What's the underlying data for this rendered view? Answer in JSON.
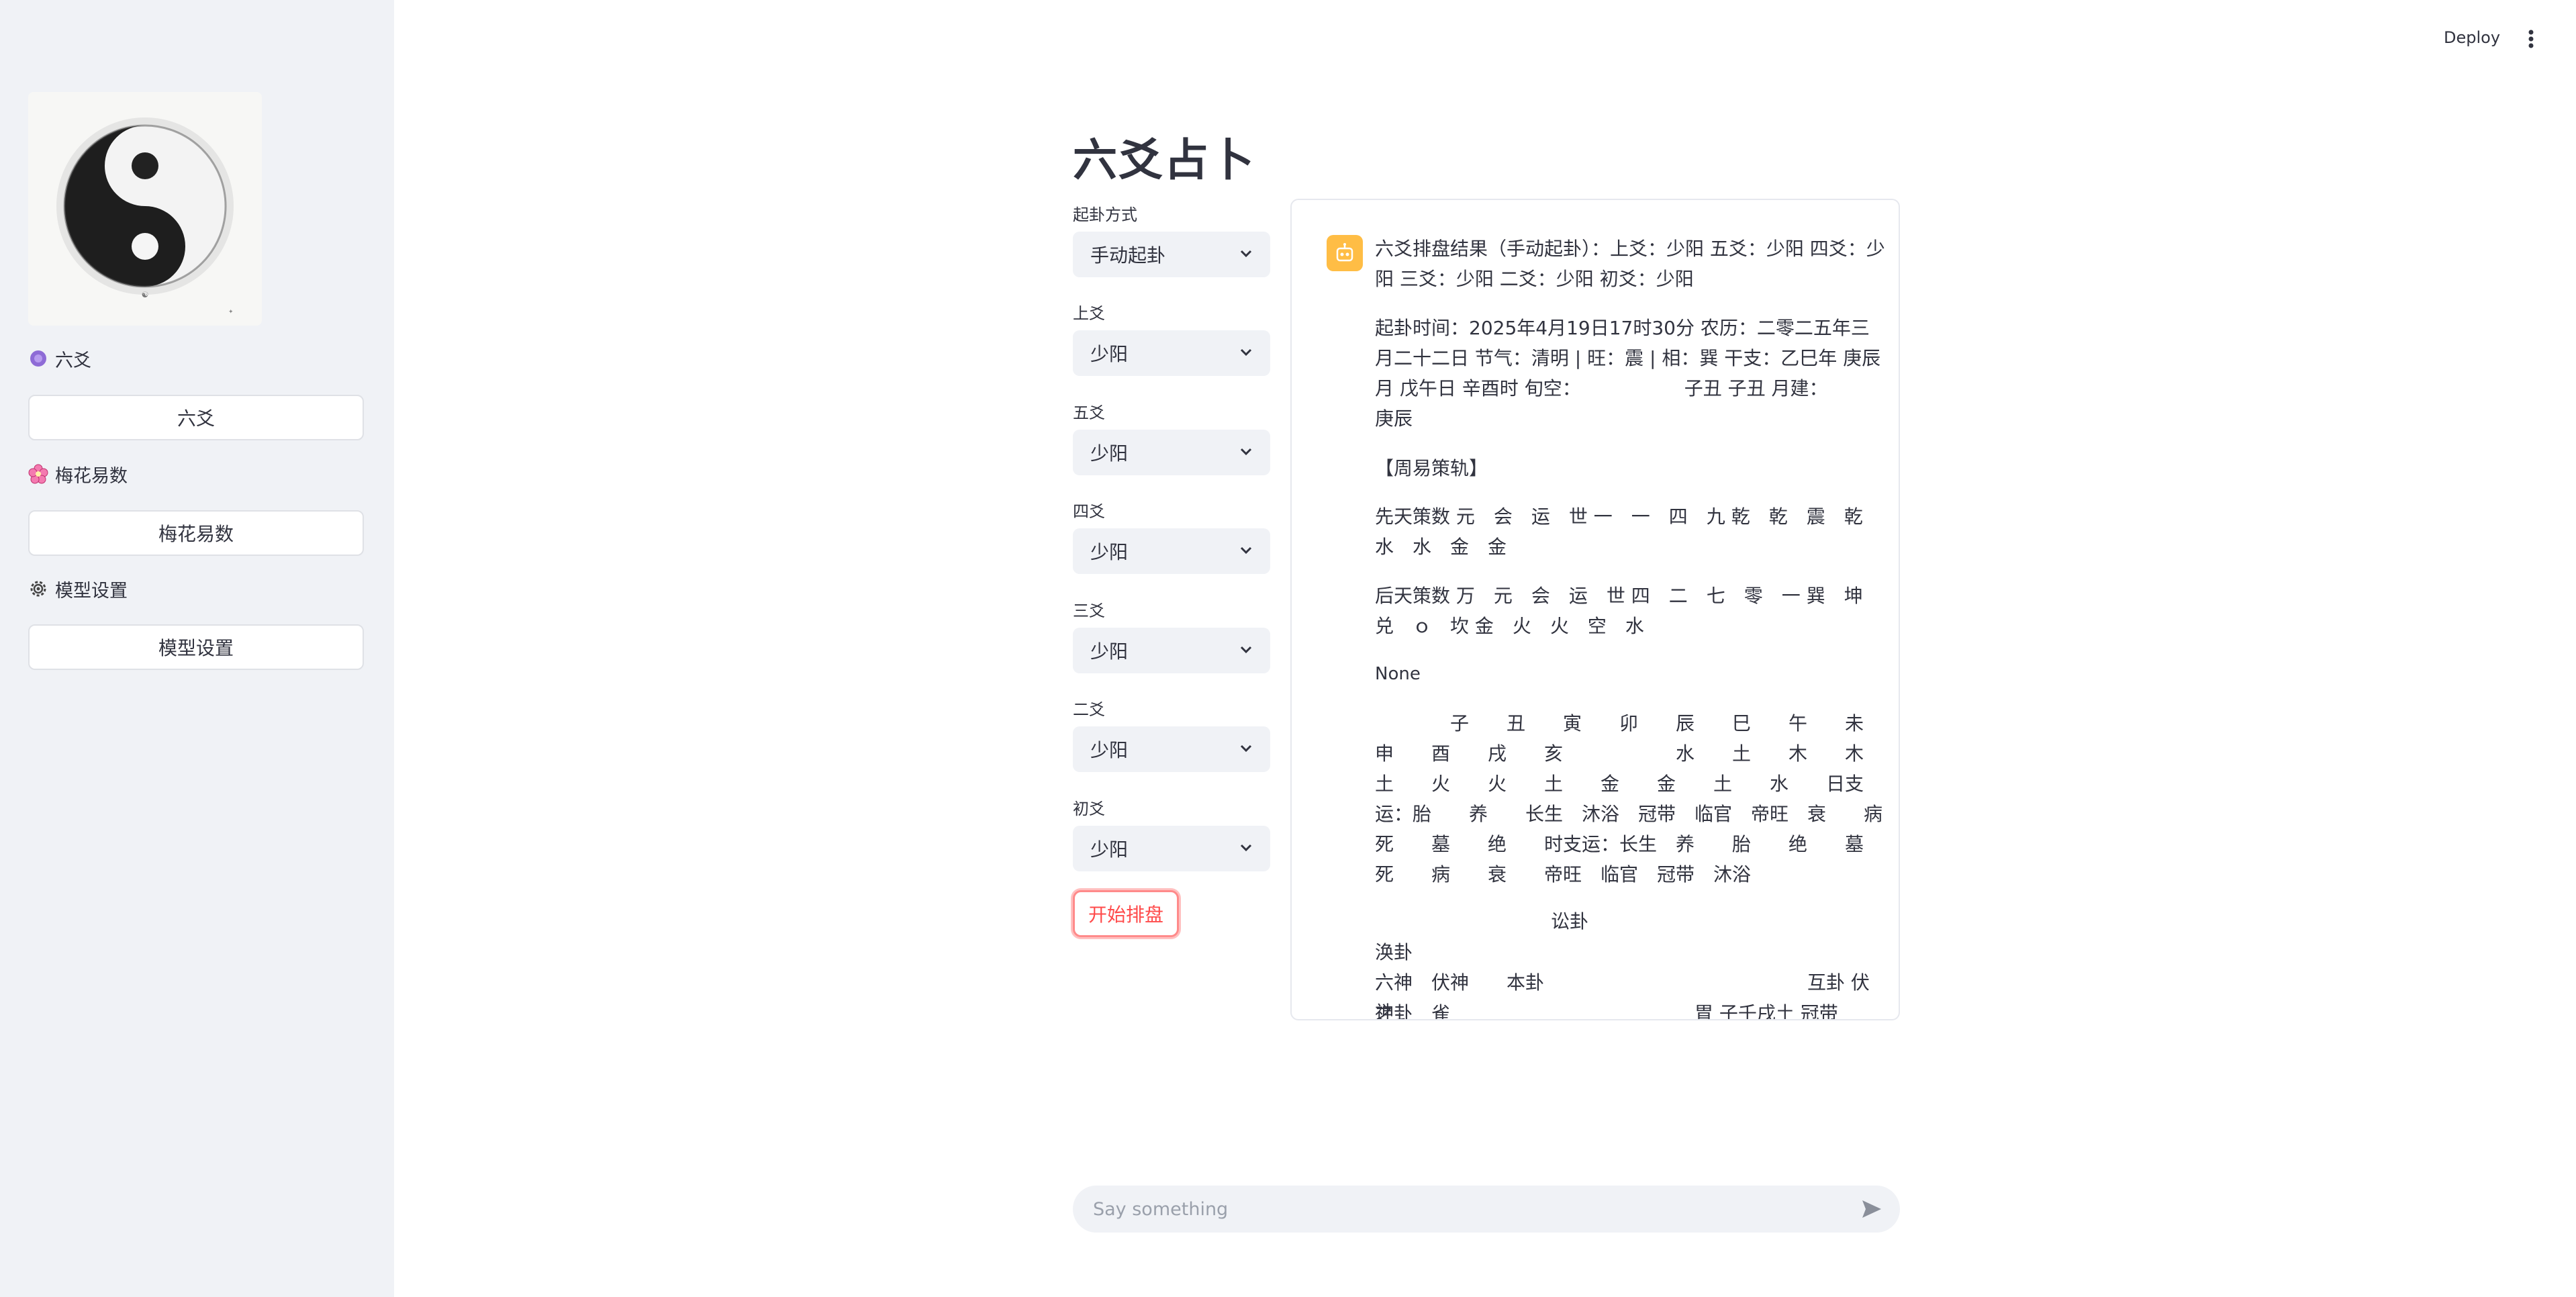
{
  "topbar": {
    "deploy_label": "Deploy",
    "more_icon": "vertical-dots-icon"
  },
  "sidebar": {
    "logo_icon": "yin-yang-ink-image",
    "items": [
      {
        "icon": "purple-circle-icon",
        "label": "六爻",
        "button_label": "六爻"
      },
      {
        "icon": "cherry-blossom-icon",
        "label": "梅花易数",
        "button_label": "梅花易数"
      },
      {
        "icon": "gear-icon",
        "label": "模型设置",
        "button_label": "模型设置"
      }
    ]
  },
  "main": {
    "title": "六爻占卜",
    "fields": [
      {
        "label": "起卦方式",
        "value": "手动起卦"
      },
      {
        "label": "上爻",
        "value": "少阳"
      },
      {
        "label": "五爻",
        "value": "少阳"
      },
      {
        "label": "四爻",
        "value": "少阳"
      },
      {
        "label": "三爻",
        "value": "少阳"
      },
      {
        "label": "二爻",
        "value": "少阳"
      },
      {
        "label": "初爻",
        "value": "少阳"
      }
    ],
    "start_button": "开始排盘"
  },
  "result": {
    "avatar_icon": "robot-icon",
    "header": "六爻排盘结果（手动起卦）：上爻：少阳 五爻：少阳 四爻：少阳 三爻：少阳 二爻：少阳 初爻：少阳",
    "time_info": "起卦时间：2025年4月19日17时30分 农历：二零二五年三月二十二日 节气：清明 | 旺：震 | 相：巽 干支：乙巳年 庚辰月 戊午日 辛酉时 旬空：　　　　　　子丑 子丑 月建：　　　庚辰",
    "zhouyi_title": "【周易策轨】",
    "xiantian": "先天策数 元　会　运　世 一　一　四　九 乾　乾　震　乾　水　水　金　金",
    "houtian": "后天策数 万　元　会　运　世 四　二　七　零　一 巽　坤　兑　ｏ　坎 金　火　火　空　水",
    "none_text": "None",
    "table": "　　　　子　　丑　　寅　　卯　　辰　　巳　　午　　未　　申　　酉　　戌　　亥　　　　　　水　　土　　木　　木　　土　　火　　火　　土　　金　　金　　土　　水　　日支运：胎　　养　　长生　沐浴　冠带　临官　帝旺　衰　　病　　死　　墓　　绝　　时支运：长生　养　　胎　　绝　　墓　　死　　病　　衰　　帝旺　临官　冠带　沐浴",
    "gua_center": "讼卦",
    "gua_name": "涣卦",
    "header_row": "六神　伏神　　本卦　　　　　　　　　　　　　　互卦 伏神",
    "last_row": "之卦　雀　　　　　　　　　　　　　胃 子壬戌土 冠带"
  },
  "chat": {
    "placeholder": "Say something",
    "send_icon": "send-arrow-icon"
  }
}
